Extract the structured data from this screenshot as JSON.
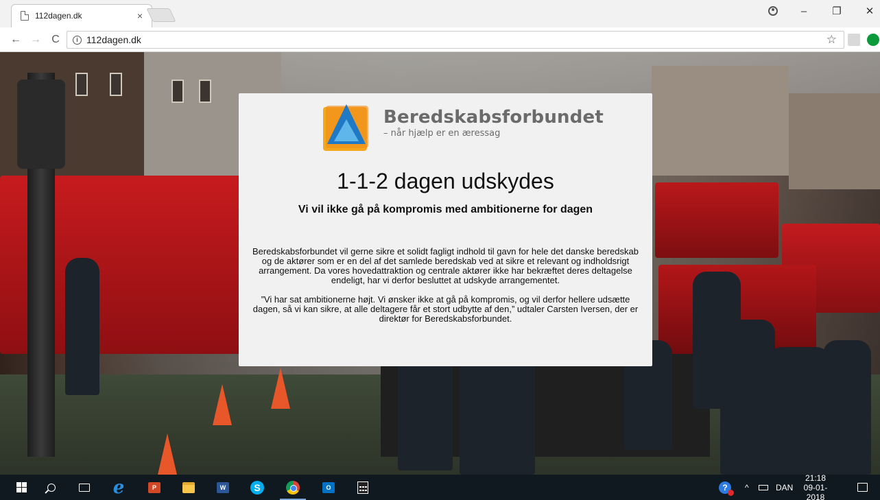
{
  "browser": {
    "tab_title": "112dagen.dk",
    "tab_close": "×",
    "url": "112dagen.dk",
    "back": "←",
    "forward": "→",
    "reload": "C",
    "info": "i",
    "star": "☆",
    "minimize": "–",
    "maximize": "❐",
    "close": "✕"
  },
  "page": {
    "logo_name": "Beredskabsforbundet",
    "logo_tagline": "– når hjælp er en æressag",
    "headline": "1-1-2 dagen udskydes",
    "subheadline": "Vi vil ikke gå på kompromis med ambitionerne for dagen",
    "paragraph1": "Beredskabsforbundet vil gerne sikre et solidt fagligt indhold til gavn for hele det danske beredskab og de aktører som er en del af det samlede beredskab ved at sikre et relevant og indholdsrigt arrangement. Da vores hovedattraktion og centrale aktører ikke har bekræftet deres deltagelse endeligt, har vi derfor besluttet at udskyde arrangementet.",
    "paragraph2": "”Vi har sat ambitionerne højt. Vi ønsker ikke at gå på kompromis, og vil derfor hellere udsætte dagen, så vi kan sikre, at alle deltagere får et stort udbytte af den,” udtaler Carsten Iversen, der er direktør for Beredskabsforbundet."
  },
  "taskbar": {
    "apps": [
      "start",
      "search",
      "task-view",
      "internet-explorer",
      "powerpoint",
      "file-explorer",
      "word",
      "skype",
      "chrome",
      "outlook",
      "calculator"
    ],
    "ie_glyph": "e",
    "ppt_label": "P",
    "word_label": "W",
    "skype_label": "S",
    "outlook_label": "O",
    "help_glyph": "?",
    "chevron": "^",
    "language": "DAN",
    "time": "21:18",
    "date": "09-01-2018"
  }
}
